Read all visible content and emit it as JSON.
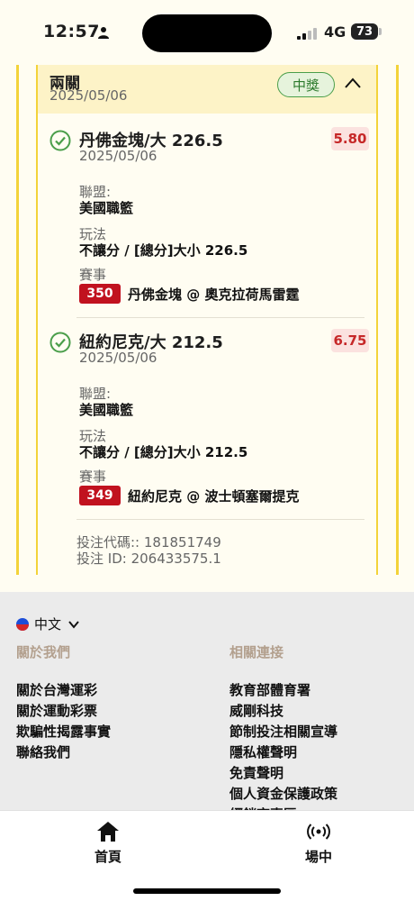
{
  "status_bar": {
    "time": "12:57",
    "network": "4G",
    "battery": "73"
  },
  "bet_card": {
    "title": "兩關",
    "date": "2025/05/06",
    "status_badge": "中獎",
    "legs": [
      {
        "selection": "丹佛金塊/大 226.5",
        "date": "2025/05/06",
        "odds": "5.80",
        "league_label": "聯盟:",
        "league": "美國職籃",
        "play_label": "玩法",
        "play": "不讓分 / [總分]大小 226.5",
        "event_label": "賽事",
        "event_number": "350",
        "event_name": "丹佛金塊 @ 奧克拉荷馬雷霆"
      },
      {
        "selection": "紐約尼克/大 212.5",
        "date": "2025/05/06",
        "odds": "6.75",
        "league_label": "聯盟:",
        "league": "美國職籃",
        "play_label": "玩法",
        "play": "不讓分 / [總分]大小 212.5",
        "event_label": "賽事",
        "event_number": "349",
        "event_name": "紐約尼克 @ 波士頓塞爾提克"
      }
    ],
    "bet_code": "投注代碼:: 181851749",
    "bet_id": "投注 ID: 206433575.1"
  },
  "footer": {
    "language": "中文",
    "about_heading": "關於我們",
    "about_links": [
      "關於台灣運彩",
      "關於運動彩票",
      "欺騙性揭露事實",
      "聯絡我們"
    ],
    "related_heading": "相關連接",
    "related_links": [
      "教育部體育署",
      "威剛科技",
      "節制投注相關宣導",
      "隱私權聲明",
      "免責聲明",
      "個人資金保護政策",
      "經銷商專區"
    ]
  },
  "tabbar": {
    "home_label": "首頁",
    "live_label": "場中"
  },
  "colors": {
    "card_border": "#f3d33a",
    "header_bg": "#fdf3c7",
    "win_green": "#4a9e4a",
    "odds_red": "#c62828",
    "event_badge": "#c1121f",
    "footer_bg": "#ebebeb"
  }
}
